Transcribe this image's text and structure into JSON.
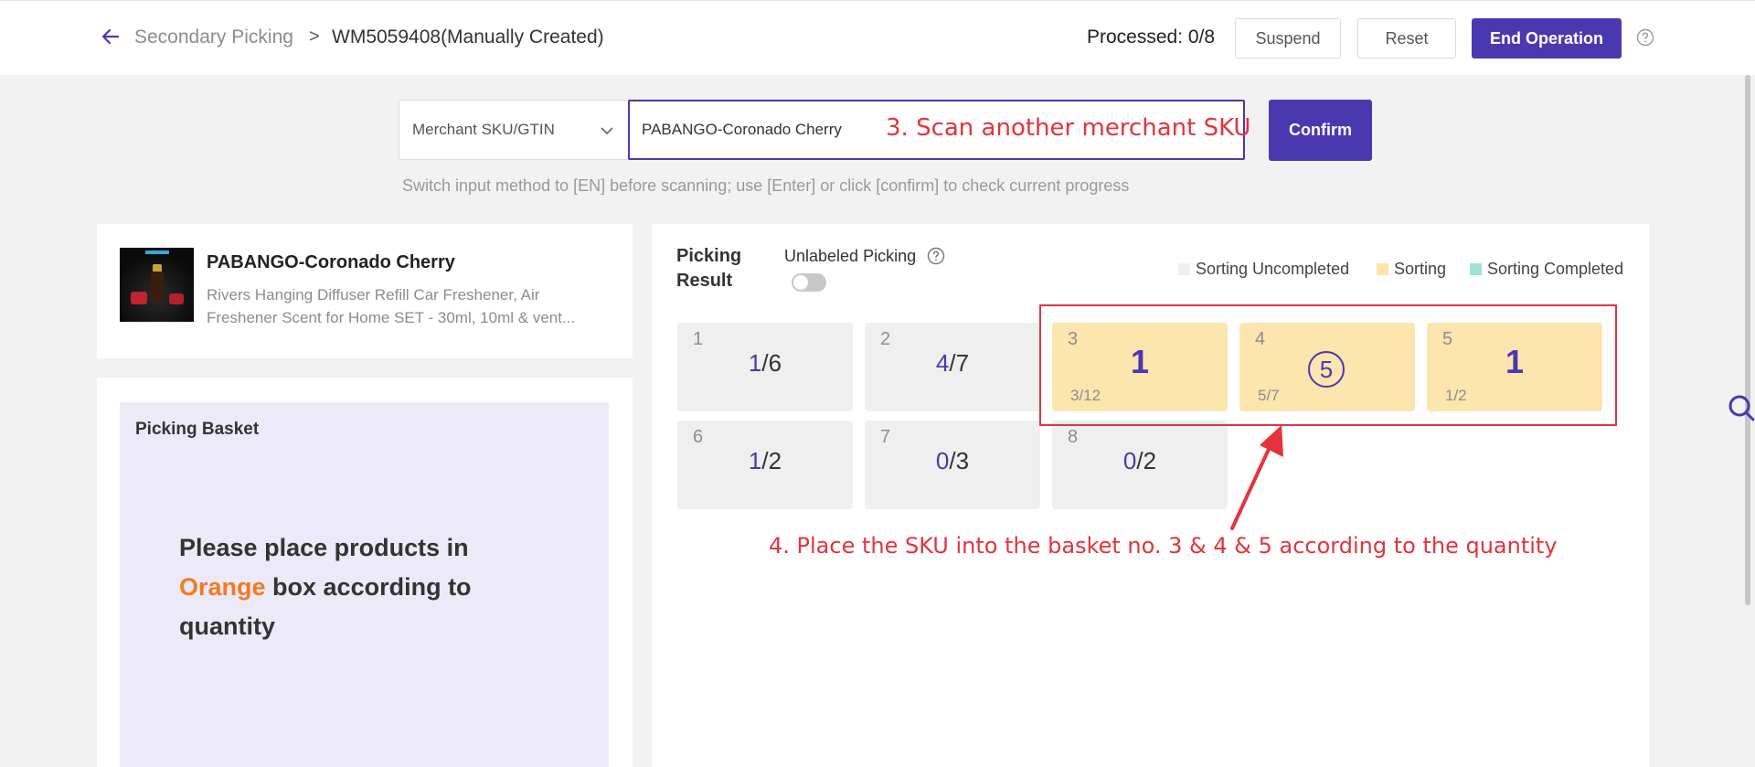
{
  "header": {
    "breadcrumb_parent": "Secondary Picking",
    "breadcrumb_separator": ">",
    "breadcrumb_current": "WM5059408(Manually Created)",
    "processed": "Processed: 0/8",
    "suspend_label": "Suspend",
    "reset_label": "Reset",
    "end_label": "End Operation"
  },
  "scan": {
    "method": "Merchant SKU/GTIN",
    "value": "PABANGO-Coronado Cherry",
    "confirm_label": "Confirm",
    "hint": "Switch input method to [EN] before scanning; use [Enter] or click [confirm] to check current progress"
  },
  "annotations": {
    "step3": "3. Scan another merchant SKU",
    "step4": "4. Place the SKU into the basket no. 3 & 4 & 5 according to the quantity"
  },
  "product": {
    "name": "PABANGO-Coronado Cherry",
    "description": "Rivers Hanging Diffuser Refill Car Freshener, Air Freshener Scent for Home SET - 30ml, 10ml & vent..."
  },
  "basket": {
    "title": "Picking Basket",
    "msg_before": "Please place products in ",
    "msg_highlight": "Orange",
    "msg_after": " box according to quantity"
  },
  "result": {
    "title": "Picking Result",
    "unlabeled_label": "Unlabeled Picking",
    "unlabeled_enabled": false,
    "legend": [
      {
        "label": "Sorting Uncompleted",
        "color": "#efefef"
      },
      {
        "label": "Sorting",
        "color": "#fde5ae"
      },
      {
        "label": "Sorting Completed",
        "color": "#9fe3d5"
      }
    ],
    "cells": [
      {
        "index": "1",
        "picked": "1",
        "total": "/6"
      },
      {
        "index": "2",
        "picked": "4",
        "total": "/7"
      },
      {
        "index": "3",
        "place_qty": "1",
        "progress": "3/12"
      },
      {
        "index": "4",
        "place_qty": "5",
        "progress": "5/7"
      },
      {
        "index": "5",
        "place_qty": "1",
        "progress": "1/2"
      },
      {
        "index": "6",
        "picked": "1",
        "total": "/2"
      },
      {
        "index": "7",
        "picked": "0",
        "total": "/3"
      },
      {
        "index": "8",
        "picked": "0",
        "total": "/2"
      }
    ]
  },
  "colors": {
    "accent": "#4a38b0",
    "sorting": "#fde5ae",
    "uncompleted": "#efefef",
    "completed": "#9fe3d5",
    "annotation": "#e5333b",
    "orange_text": "#f47920"
  },
  "icons": {
    "back": "arrow-left-icon",
    "help": "question-circle-icon",
    "dropdown": "chevron-down-icon",
    "search": "search-icon"
  }
}
